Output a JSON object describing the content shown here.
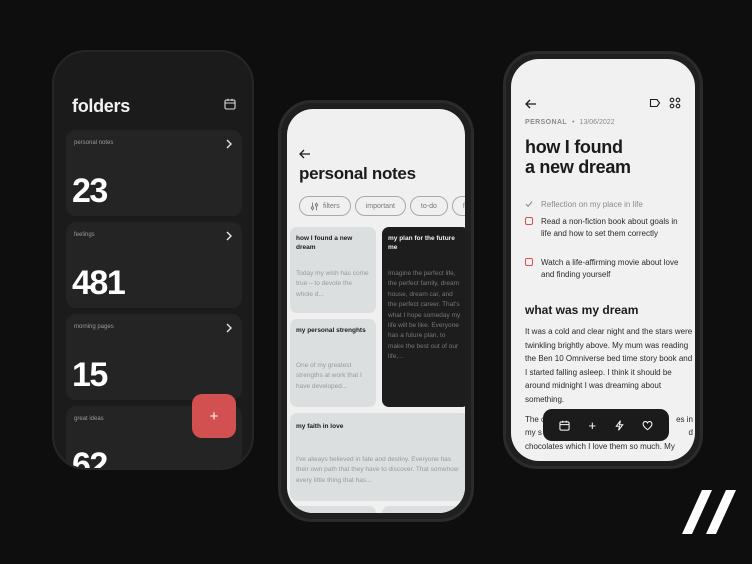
{
  "folders_screen": {
    "title": "folders",
    "folders": [
      {
        "name": "personal notes",
        "count": "23"
      },
      {
        "name": "feelings",
        "count": "481"
      },
      {
        "name": "morning pages",
        "count": "15"
      },
      {
        "name": "great ideas",
        "count": "62"
      }
    ],
    "fab_label": "+"
  },
  "notes_screen": {
    "title": "personal notes",
    "chips": [
      "filters",
      "important",
      "to-do",
      "favo"
    ],
    "notes": [
      {
        "title": "how I found a new dream",
        "body": "Today my wish has come true – to devote the whole d..."
      },
      {
        "title": "my plan for the future me",
        "body": "Imagine the perfect life, the perfect family, dream house, dream car, and the perfect career. That's what I hope someday my life will be like. Everyone has a future plan, to make the best out of our life,..."
      },
      {
        "title": "my personal strenghts",
        "body": "One of my greatest strengths at work that I have developed..."
      },
      {
        "title": "my faith in love",
        "body": "I've always believed in fate and destiny. Everyone has their own path that they have to discover. That somehow every little thing that has..."
      }
    ]
  },
  "detail_screen": {
    "category": "PERSONAL",
    "date": "13/06/2022",
    "title_line1": "how I found",
    "title_line2": "a new dream",
    "checklist": [
      {
        "text": "Reflection on my place in life",
        "done": true
      },
      {
        "text": "Read a non-fiction book about goals in life and how to set them correctly",
        "done": false
      },
      {
        "text": "Watch a life-affirming movie about love and finding yourself",
        "done": false
      }
    ],
    "subtitle": "what was my dream",
    "body": "It was a cold and clear night and the stars were twinkling brightly above. My mum was reading the Ben 10 Omniverse bed time story book and I started falling asleep. I think it should be around midnight I was dreaming about something.",
    "body_cont_start": "The c",
    "body_cont_end": "es in",
    "body_line2_start": "my s",
    "body_line2_end": "d",
    "body_line3": "chocolates which I love them so much. My",
    "toolbar_add": "+"
  },
  "colors": {
    "accent": "#d25050",
    "dark": "#1b1b1b",
    "light": "#f0f0f0"
  }
}
